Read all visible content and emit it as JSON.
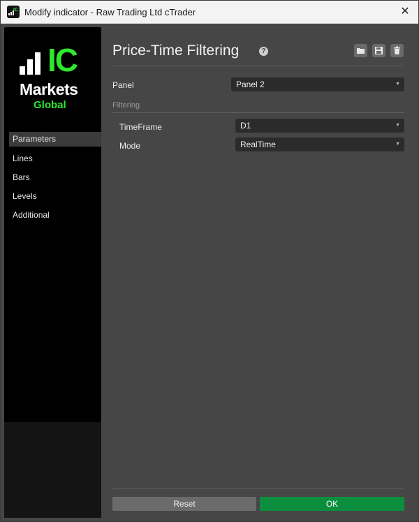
{
  "window": {
    "title": "Modify indicator - Raw Trading Ltd cTrader",
    "close_glyph": "✕"
  },
  "brand": {
    "ic": "IC",
    "markets": "Markets",
    "global": "Global",
    "green": "#2ee82e"
  },
  "sidebar": {
    "items": [
      {
        "label": "Parameters",
        "active": true
      },
      {
        "label": "Lines"
      },
      {
        "label": "Bars"
      },
      {
        "label": "Levels"
      },
      {
        "label": "Additional"
      }
    ]
  },
  "main": {
    "title": "Price-Time Filtering",
    "help_icon": "help-icon",
    "tools": [
      "open-folder-icon",
      "save-icon",
      "delete-icon"
    ],
    "panel": {
      "label": "Panel",
      "value": "Panel 2"
    },
    "filtering": {
      "section": "Filtering",
      "timeframe": {
        "label": "TimeFrame",
        "value": "D1"
      },
      "mode": {
        "label": "Mode",
        "value": "RealTime"
      }
    },
    "buttons": {
      "reset": "Reset",
      "ok": "OK"
    }
  },
  "colors": {
    "ok_button": "#0b8f3e",
    "reset_button": "#6b6b6b",
    "background": "#464646"
  }
}
